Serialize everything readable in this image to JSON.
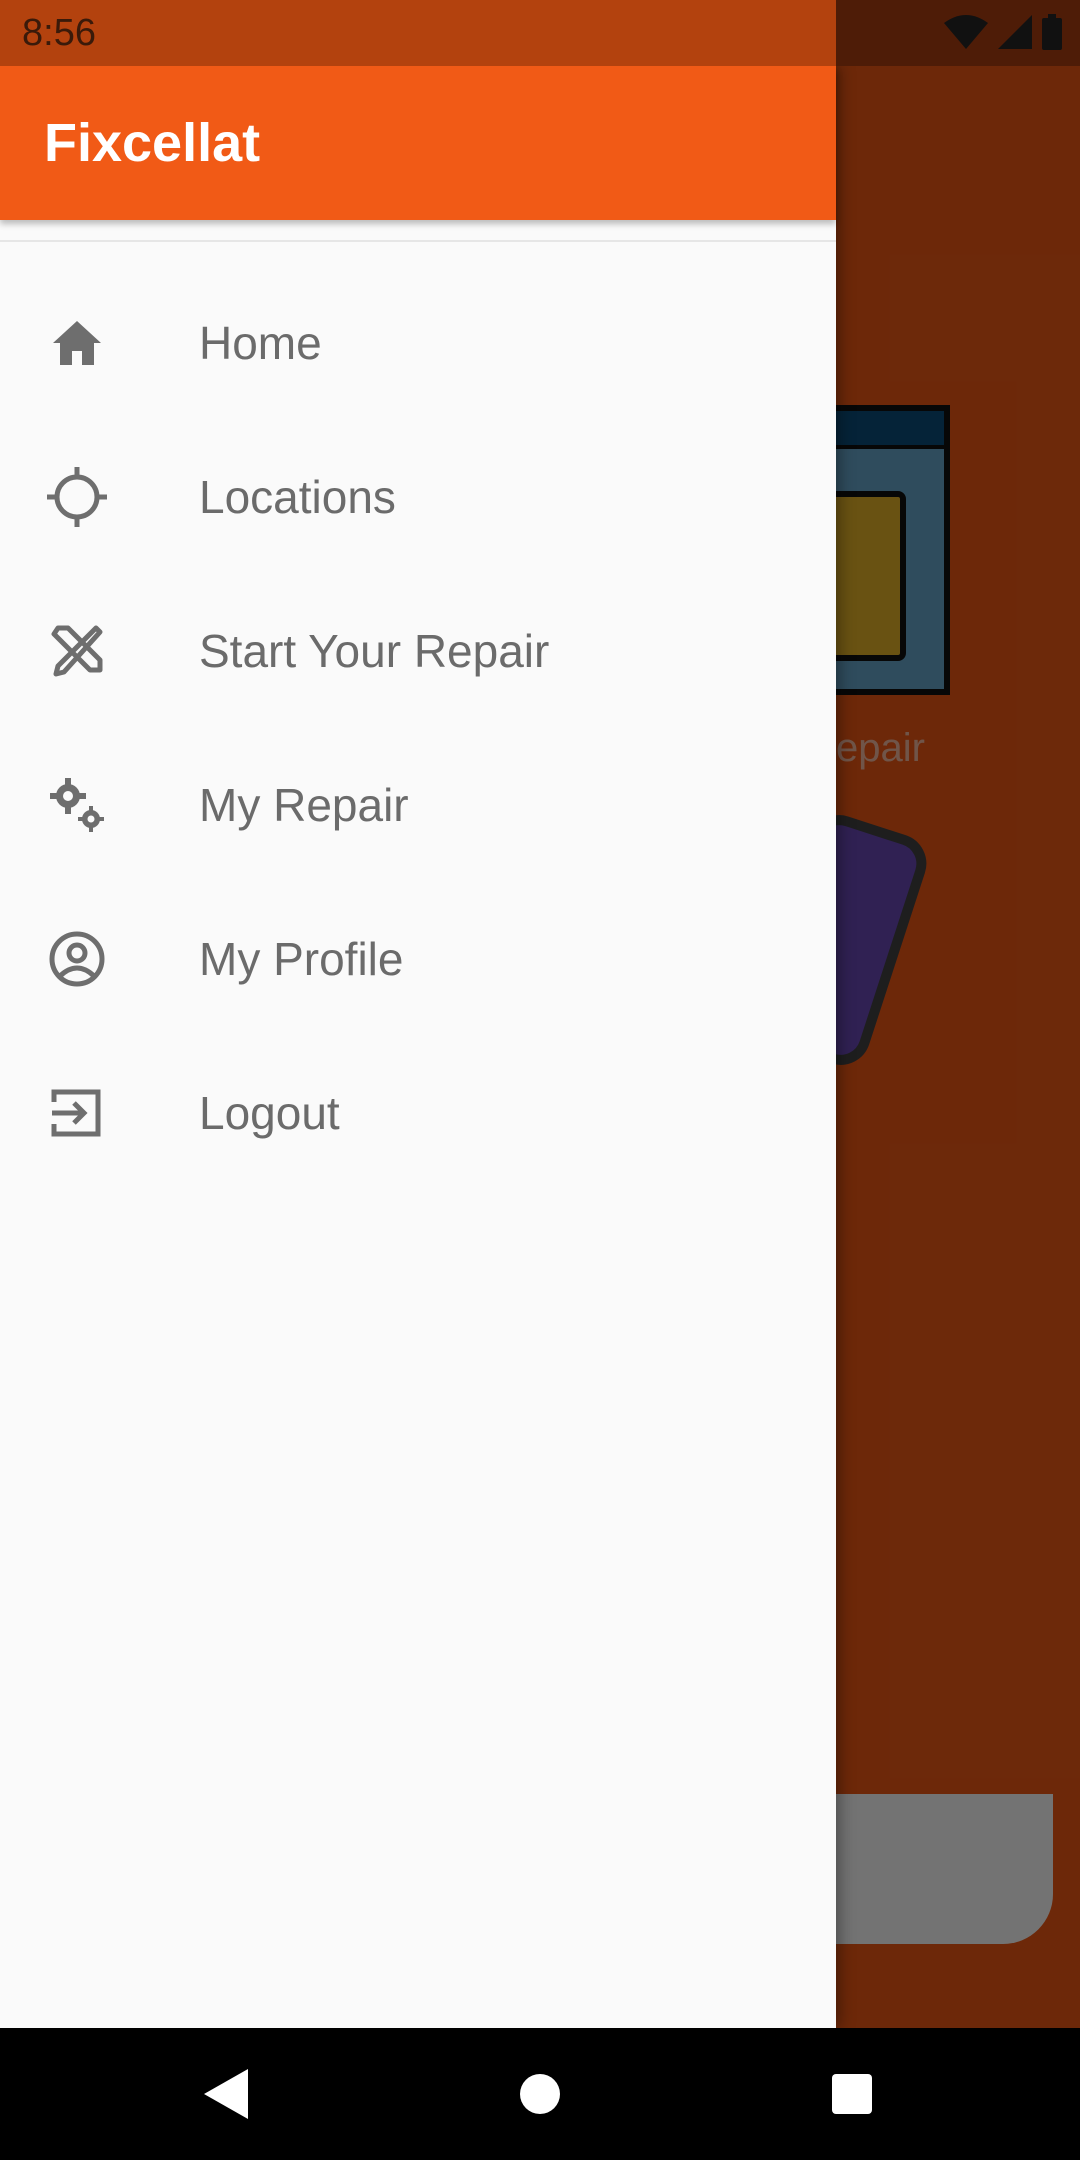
{
  "status_bar": {
    "time": "8:56",
    "icons": [
      "wifi-icon",
      "signal-icon",
      "battery-icon"
    ]
  },
  "background_screen": {
    "card_label": "epair"
  },
  "drawer": {
    "title": "Fixcellat",
    "menu": [
      {
        "label": "Home",
        "icon": "home-icon"
      },
      {
        "label": "Locations",
        "icon": "crosshair-icon"
      },
      {
        "label": "Start Your Repair",
        "icon": "tools-icon"
      },
      {
        "label": "My Repair",
        "icon": "gears-icon"
      },
      {
        "label": "My Profile",
        "icon": "profile-icon"
      },
      {
        "label": "Logout",
        "icon": "logout-icon"
      }
    ]
  },
  "nav_bar": {
    "buttons": [
      "back-icon",
      "home-circle-icon",
      "recents-icon"
    ]
  },
  "colors": {
    "accent": "#f15a16",
    "drawer_bg": "#fafafa",
    "menu_text": "#6b6b6b",
    "icon": "#6e6e6e"
  }
}
